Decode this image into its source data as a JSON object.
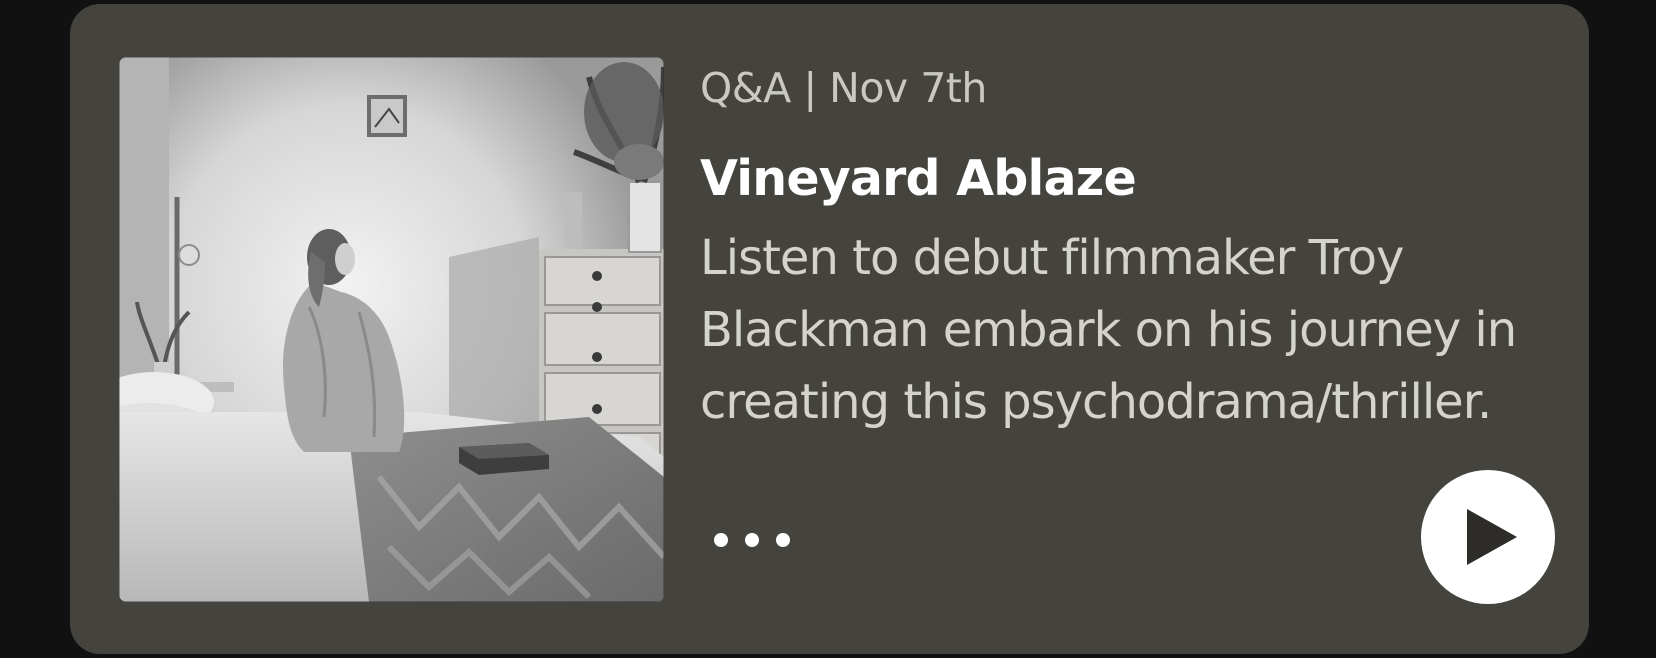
{
  "card": {
    "meta": "Q&A | Nov 7th",
    "title": "Vineyard Ablaze",
    "description": "Listen to debut filmmaker Troy Blackman embark on his journey in creating this psychodrama/thriller.",
    "more_icon": "ellipsis-icon",
    "play_icon": "play-icon",
    "thumbnail_style": "grayscale"
  },
  "colors": {
    "page_background": "#111111",
    "card_background": "#44433d",
    "meta_text": "#c9c8c2",
    "title_text": "#ffffff",
    "description_text": "#d4d3cd",
    "play_button": "#ffffff",
    "play_glyph": "#2d2c28"
  }
}
